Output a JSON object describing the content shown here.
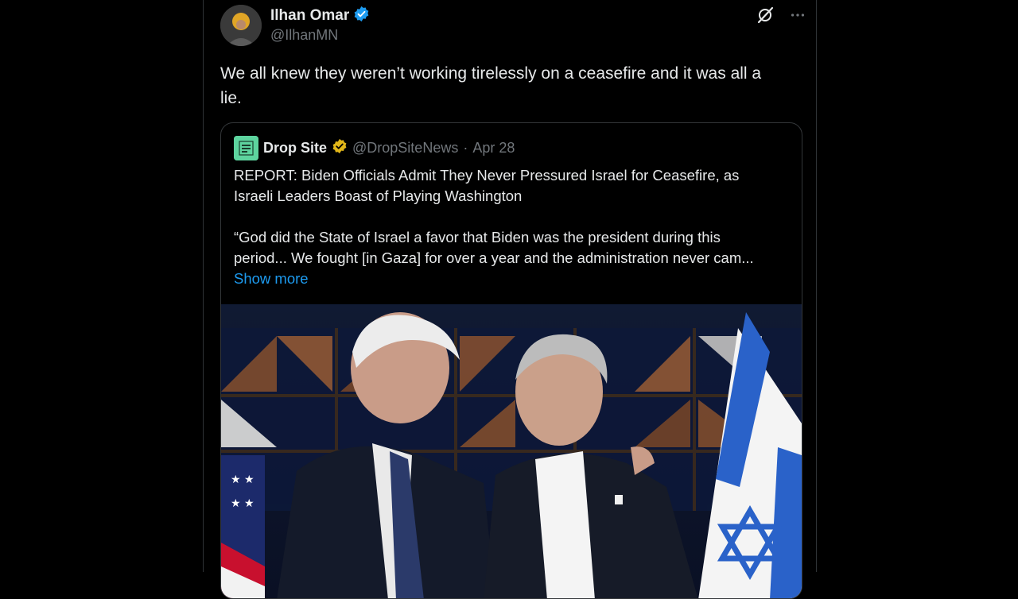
{
  "tweet": {
    "author_name": "Ilhan Omar",
    "handle": "@IlhanMN",
    "verified_badge": "blue-check-icon",
    "text": "We all knew they weren’t working tirelessly on a ceasefire and it was all a lie.",
    "text_lines": [
      "We all knew they weren’t working tirelessly on a ceasefire and it was all a",
      "lie."
    ],
    "actions": [
      "grok-icon",
      "more-icon"
    ]
  },
  "quote": {
    "author_name": "Drop Site",
    "verified_badge": "gold-check-icon",
    "handle": "@DropSiteNews",
    "separator": "·",
    "date": "Apr 28",
    "headline_lines": [
      "REPORT: Biden Officials Admit They Never Pressured Israel for Ceasefire, as",
      "Israeli Leaders Boast of Playing Washington"
    ],
    "body_lines": [
      "“God did the State of Israel a favor that Biden was the president during this",
      "period... We fought [in Gaza] for over a year and the administration never cam..."
    ],
    "show_more": "Show more"
  },
  "colors": {
    "background": "#000000",
    "text": "#e7e9ea",
    "muted": "#71767b",
    "link": "#1d9bf0",
    "border": "#2f3336",
    "verified_blue": "#1d9bf0",
    "verified_gold": "#e2b719",
    "drop_site_logo": "#5dd39e"
  }
}
